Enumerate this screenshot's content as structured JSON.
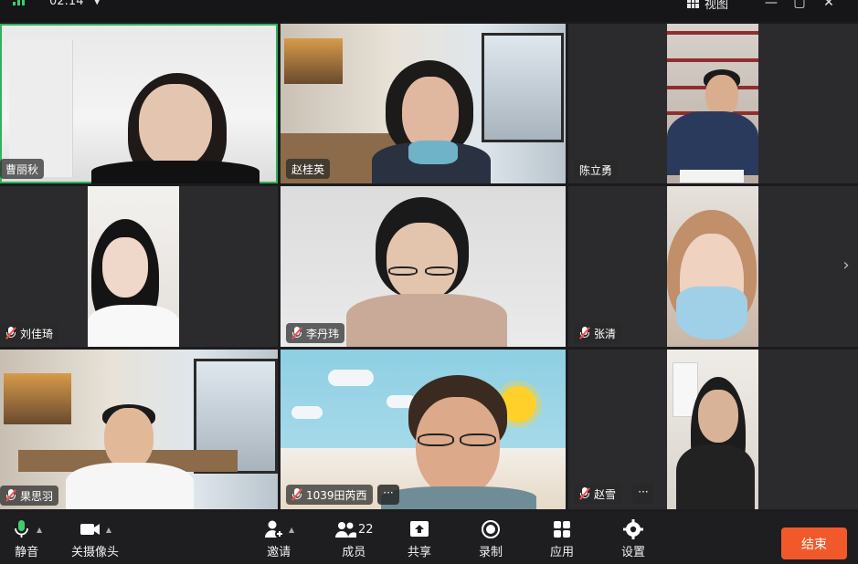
{
  "topbar": {
    "timer": "02:14",
    "view_label": "视图",
    "minimize": "—",
    "maximize": "▢",
    "close": "✕"
  },
  "participants": [
    {
      "name": "曹丽秋",
      "muted": false
    },
    {
      "name": "赵桂英",
      "muted": false
    },
    {
      "name": "陈立勇",
      "muted": false
    },
    {
      "name": "刘佳琦",
      "muted": true
    },
    {
      "name": "李丹玮",
      "muted": true
    },
    {
      "name": "张清",
      "muted": true
    },
    {
      "name": "果思羽",
      "muted": true
    },
    {
      "name": "1039田芮西",
      "muted": true
    },
    {
      "name": "赵雪",
      "muted": true
    }
  ],
  "more_label": "···",
  "toolbar": {
    "mute": "静音",
    "camera": "关摄像头",
    "invite": "邀请",
    "members": "成员",
    "member_count": "22",
    "share": "共享",
    "record": "录制",
    "apps": "应用",
    "settings": "设置",
    "end": "结束"
  },
  "colors": {
    "accent_green": "#2fb35a",
    "end_button": "#f2592a",
    "muted_red": "#ff4d4f"
  }
}
